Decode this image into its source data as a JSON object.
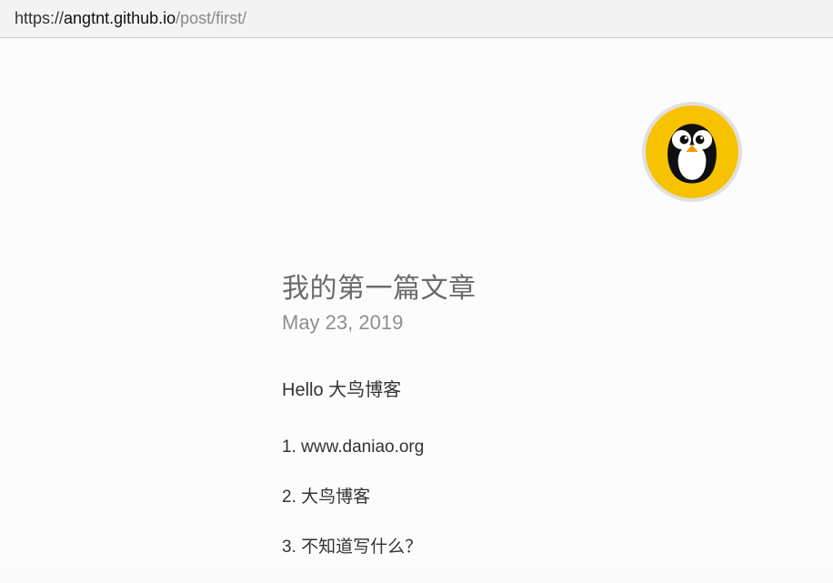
{
  "address_bar": {
    "protocol": "https://",
    "domain": "angtnt.github.io",
    "path": "/post/first/"
  },
  "avatar": {
    "name": "penguin-avatar"
  },
  "article": {
    "title": "我的第一篇文章",
    "date": "May 23, 2019",
    "intro": "Hello 大鸟博客",
    "list": [
      "www.daniao.org",
      "大鸟博客",
      "不知道写什么？"
    ]
  }
}
